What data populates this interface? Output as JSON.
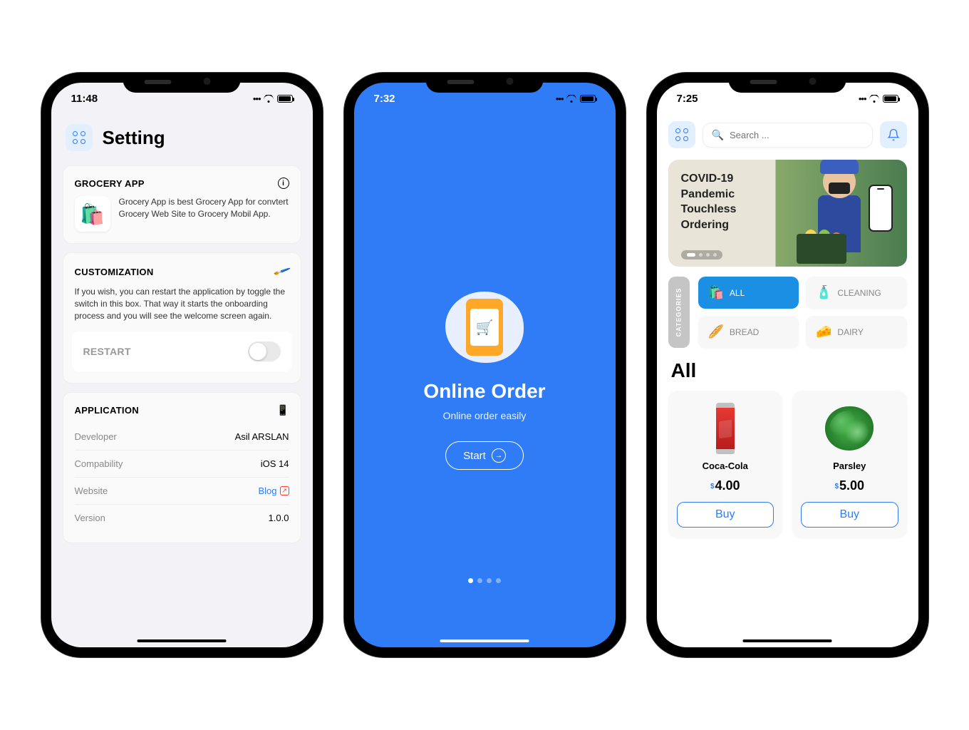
{
  "phone1": {
    "time": "11:48",
    "title": "Setting",
    "grocery": {
      "header": "GROCERY APP",
      "desc": "Grocery App is best Grocery App for convtert Grocery Web Site to Grocery Mobil App."
    },
    "custom": {
      "header": "CUSTOMIZATION",
      "desc": "If you wish, you can restart the application by toggle the switch in this box. That way it starts the onboarding process and you will see the welcome screen again.",
      "restart": "RESTART"
    },
    "app": {
      "header": "APPLICATION",
      "rows": [
        {
          "k": "Developer",
          "v": "Asil ARSLAN"
        },
        {
          "k": "Compability",
          "v": "iOS 14"
        },
        {
          "k": "Website",
          "v": "Blog"
        },
        {
          "k": "Version",
          "v": "1.0.0"
        }
      ]
    }
  },
  "phone2": {
    "time": "7:32",
    "title": "Online Order",
    "subtitle": "Online order easily",
    "start": "Start"
  },
  "phone3": {
    "time": "7:25",
    "search_placeholder": "Search ...",
    "banner": "COVID-19\nPandemic\nTouchless\nOrdering",
    "cat_label": "CATEGORIES",
    "cats": [
      {
        "label": "ALL"
      },
      {
        "label": "CLEANING"
      },
      {
        "label": "BREAD"
      },
      {
        "label": "DAIRY"
      }
    ],
    "section": "All",
    "products": [
      {
        "name": "Coca-Cola",
        "price": "4.00",
        "buy": "Buy"
      },
      {
        "name": "Parsley",
        "price": "5.00",
        "buy": "Buy"
      }
    ]
  }
}
